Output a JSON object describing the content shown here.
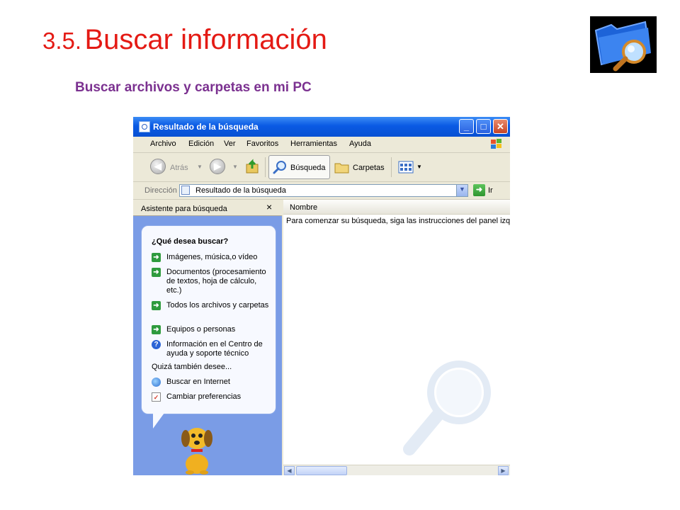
{
  "slide": {
    "title_number": "3.5.",
    "title_text": "Buscar información",
    "subtitle": "Buscar archivos y carpetas en mi PC"
  },
  "window": {
    "title": "Resultado de la búsqueda",
    "menu": [
      "Archivo",
      "Edición",
      "Ver",
      "Favoritos",
      "Herramientas",
      "Ayuda"
    ],
    "toolbar": {
      "back": "Atrás",
      "search": "Búsqueda",
      "folders": "Carpetas"
    },
    "address": {
      "label": "Dirección",
      "value": "Resultado de la búsqueda",
      "go": "Ir"
    },
    "sidebar": {
      "title": "Asistente para búsqueda",
      "close": "×",
      "question": "¿Qué desea buscar?",
      "options": [
        "Imágenes, música,o vídeo",
        "Documentos (procesamiento de textos, hoja de cálculo, etc.)",
        "Todos los archivos y carpetas",
        "Equipos o personas",
        "Información en el Centro de ayuda y soporte técnico"
      ],
      "also_label": "Quizá también desee...",
      "also_options": [
        "Buscar en Internet",
        "Cambiar preferencias"
      ]
    },
    "results": {
      "column": "Nombre",
      "message": "Para comenzar su búsqueda, siga las instrucciones del panel izqu"
    }
  },
  "colors": {
    "title_red": "#e41a14",
    "subtitle_purple": "#7b3190",
    "xp_blue": "#0a5ae4"
  }
}
